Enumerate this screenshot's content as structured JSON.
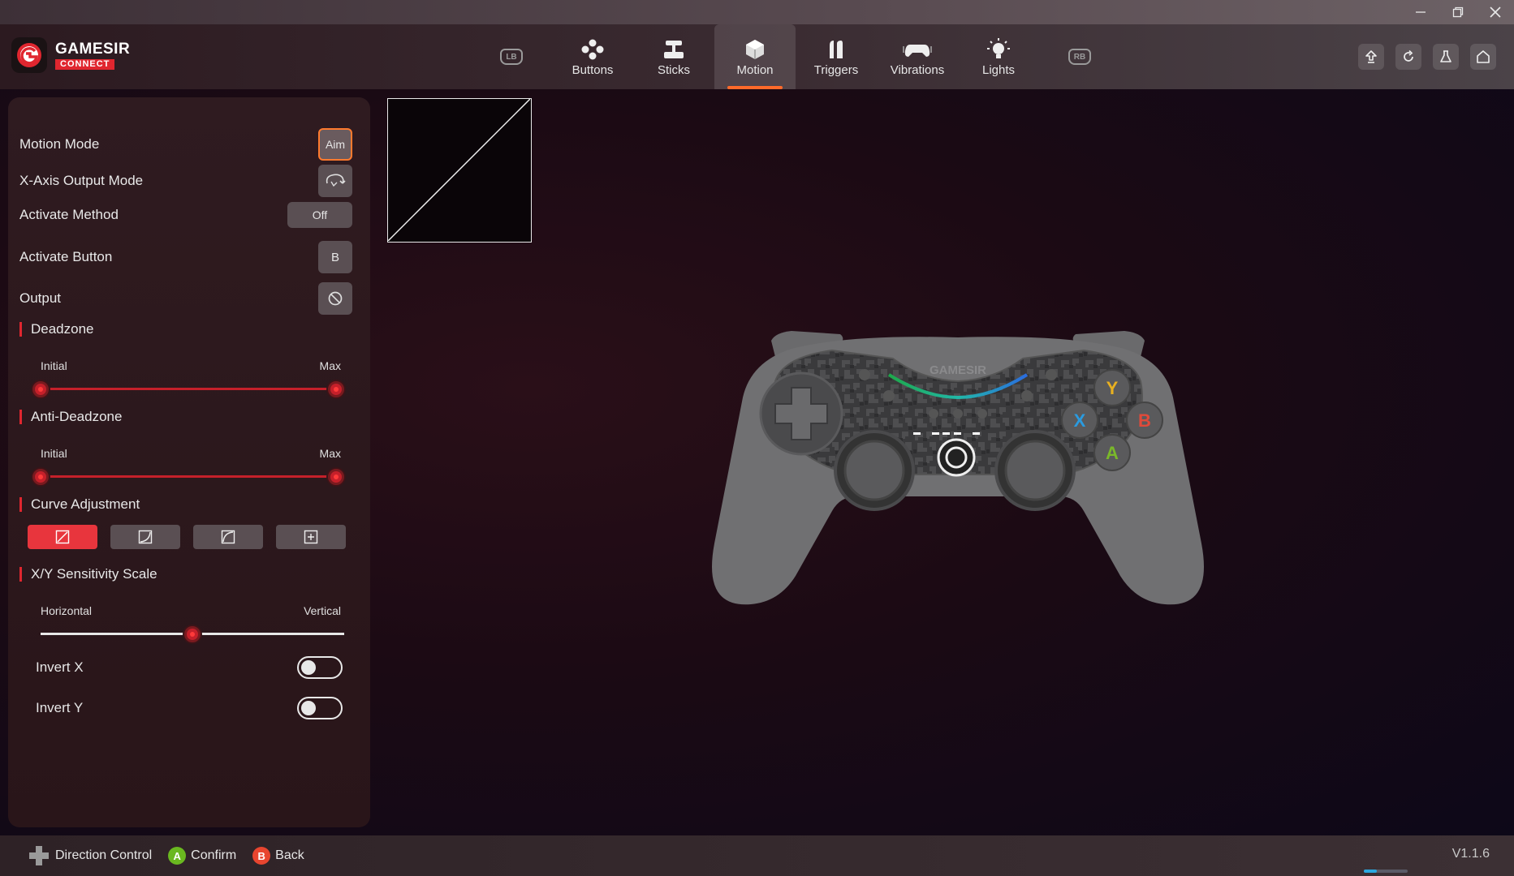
{
  "window": {
    "controls": [
      "minimize-icon",
      "restore-icon",
      "close-icon"
    ]
  },
  "header": {
    "logo": {
      "brand": "GAMESIR",
      "sub": "CONNECT"
    },
    "bumpers": {
      "left": "LB",
      "right": "RB"
    },
    "tabs": [
      {
        "label": "Buttons",
        "icon": "buttons-icon"
      },
      {
        "label": "Sticks",
        "icon": "sticks-icon"
      },
      {
        "label": "Motion",
        "icon": "motion-cube-icon",
        "active": true
      },
      {
        "label": "Triggers",
        "icon": "triggers-icon"
      },
      {
        "label": "Vibrations",
        "icon": "vibrations-icon"
      },
      {
        "label": "Lights",
        "icon": "lights-icon"
      }
    ],
    "actions": [
      "upload-icon",
      "refresh-icon",
      "flask-icon",
      "home-icon"
    ]
  },
  "panel": {
    "motion_mode": {
      "label": "Motion Mode",
      "value": "Aim"
    },
    "x_axis_output": {
      "label": "X-Axis Output Mode",
      "icon": "steering-wheel-icon"
    },
    "activate_method": {
      "label": "Activate Method",
      "value": "Off"
    },
    "activate_button": {
      "label": "Activate Button",
      "value": "B"
    },
    "output": {
      "label": "Output",
      "icon": "disabled-icon"
    },
    "deadzone": {
      "title": "Deadzone",
      "min_label": "Initial",
      "max_label": "Max",
      "low": 0,
      "high": 1
    },
    "anti_deadzone": {
      "title": "Anti-Deadzone",
      "min_label": "Initial",
      "max_label": "Max",
      "low": 0,
      "high": 1
    },
    "curve": {
      "title": "Curve Adjustment",
      "options": [
        "linear-curve-icon",
        "concave-curve-icon",
        "convex-curve-icon",
        "custom-curve-icon"
      ],
      "selected": 0
    },
    "sensitivity": {
      "title": "X/Y Sensitivity Scale",
      "min_label": "Horizontal",
      "max_label": "Vertical",
      "value": 0.5
    },
    "invert_x": {
      "label": "Invert X",
      "on": false
    },
    "invert_y": {
      "label": "Invert Y",
      "on": false
    }
  },
  "controller": {
    "brand": "GAMESIR",
    "face_buttons": {
      "y": "Y",
      "x": "X",
      "b": "B",
      "a": "A"
    },
    "colors": {
      "y": "#e8b020",
      "x": "#2a9be0",
      "b": "#e04a3a",
      "a": "#7ab82a"
    }
  },
  "footer": {
    "hints": [
      {
        "icon": "dpad-icon",
        "label": "Direction Control"
      },
      {
        "badge": "A",
        "label": "Confirm",
        "color": "#6ab820"
      },
      {
        "badge": "B",
        "label": "Back",
        "color": "#e8452f"
      }
    ],
    "version": "V1.1.6",
    "progress": 0.3
  },
  "colors": {
    "accent": "#e0262f",
    "active_tab": "#ff6a2a"
  }
}
